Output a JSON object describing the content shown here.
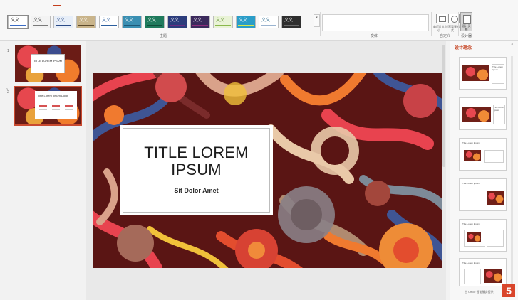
{
  "ribbon": {
    "tabs": [
      "",
      "",
      "",
      "",
      "",
      "",
      "",
      "",
      "",
      "",
      ""
    ],
    "groups": {
      "themes": "主题",
      "variants": "变体",
      "customize": "自定义",
      "designer": "设计器"
    },
    "theme_thumbs": [
      {
        "text": "文文",
        "bg": "#ffffff",
        "fg": "#222222",
        "bar": "#3b6cc4"
      },
      {
        "text": "文文",
        "bg": "#f3f3f3",
        "fg": "#333333",
        "bar": "#7a7a7a"
      },
      {
        "text": "文文",
        "bg": "#e7eef8",
        "fg": "#2a4a86",
        "bar": "#2a4a86"
      },
      {
        "text": "文文",
        "bg": "#c9b48a",
        "fg": "#ffffff",
        "bar": "#5c4a2a"
      },
      {
        "text": "文文",
        "bg": "#ffffff",
        "fg": "#2c5f9e",
        "bar": "#2c5f9e"
      },
      {
        "text": "文文",
        "bg": "#3a8fb2",
        "fg": "#ffffff",
        "bar": "#1e5a78"
      },
      {
        "text": "文文",
        "bg": "#1f7a5c",
        "fg": "#ffffff",
        "bar": "#0f4e3a"
      },
      {
        "text": "文文",
        "bg": "#2c3d7c",
        "fg": "#ffffff",
        "bar": "#6a2c82"
      },
      {
        "text": "文文",
        "bg": "#3b2a5c",
        "fg": "#ffffff",
        "bar": "#8e2c7b"
      },
      {
        "text": "文文",
        "bg": "#e9f3d6",
        "fg": "#5a8a2a",
        "bar": "#8ab84c"
      },
      {
        "text": "文文",
        "bg": "#2a9dc8",
        "fg": "#ffffff",
        "bar": "#d6e84a"
      },
      {
        "text": "文文",
        "bg": "#ffffff",
        "fg": "#2a6a8e",
        "bar": "#9ab4d0"
      },
      {
        "text": "文文",
        "bg": "#2f2f2f",
        "fg": "#ffffff",
        "bar": "#6a6a6a"
      }
    ],
    "customize_buttons": [
      "幻灯片大小",
      "设置背景格式"
    ],
    "designer_button": "设计灵感"
  },
  "thumbnails": [
    {
      "num": "1",
      "title": "TITLE LOREM IPSUM"
    },
    {
      "num": "2",
      "title": "Title Lorem Ipsum Dolor"
    }
  ],
  "slide": {
    "title": "TITLE LOREM\nIPSUM",
    "subtitle": "Sit Dolor Amet"
  },
  "design_ideas": {
    "title": "设计理念",
    "close": "×",
    "items": [
      {
        "label": "",
        "caption": "Title Lorem Ipsum"
      },
      {
        "label": "",
        "caption": "Title Lorem Ipsum"
      },
      {
        "label": "Title Lorem Ipsum",
        "caption": ""
      },
      {
        "label": "Title Lorem Ipsum",
        "caption": ""
      },
      {
        "label": "Title Lorem Ipsum",
        "caption": ""
      },
      {
        "label": "Title Lorem Ipsum",
        "caption": ""
      }
    ],
    "footer": "由 Office 智能服务提供"
  },
  "step_badge": "5"
}
